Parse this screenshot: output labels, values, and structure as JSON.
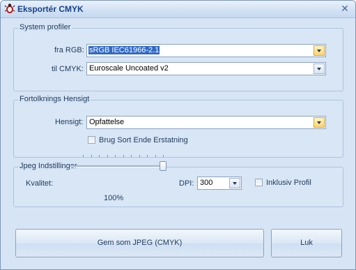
{
  "window": {
    "title": "Eksportér CMYK"
  },
  "system_profiles": {
    "legend": "System profiler",
    "rgb_label": "fra RGB:",
    "rgb_value": "sRGB IEC61966-2.1",
    "cmyk_label": "til CMYK:",
    "cmyk_value": "Euroscale Uncoated v2"
  },
  "rendering_intent": {
    "legend": "Fortolknings Hensigt",
    "intent_label": "Hensigt:",
    "intent_value": "Opfattelse",
    "black_replace_label": "Brug Sort Ende Erstatning",
    "black_replace_checked": false
  },
  "jpeg_settings": {
    "legend": "Jpeg Indstillinger",
    "quality_label": "Kvalitet:",
    "quality_value": "100%",
    "quality_fraction": 1.0,
    "dpi_label": "DPI:",
    "dpi_value": "300",
    "include_profile_label": "Inklusiv Profil",
    "include_profile_checked": false
  },
  "buttons": {
    "save_label": "Gem som JPEG (CMYK)",
    "close_label": "Luk"
  },
  "icons": {
    "app": "bug-icon",
    "close": "close-icon",
    "dropdown": "chevron-down-icon"
  }
}
